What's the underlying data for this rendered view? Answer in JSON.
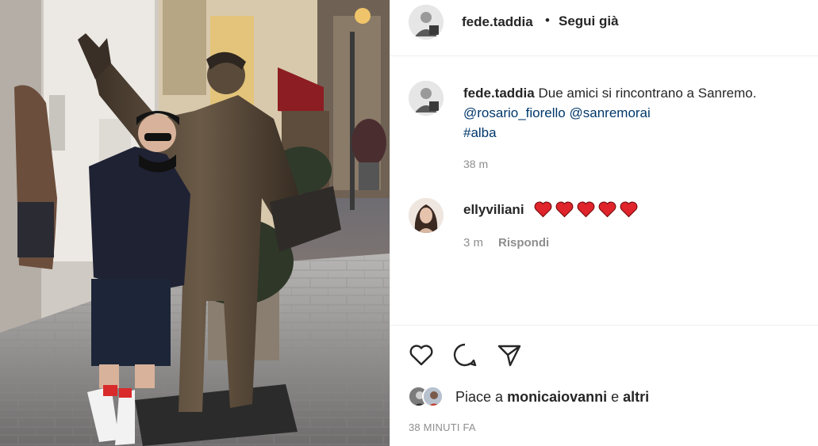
{
  "post": {
    "author": "fede.taddia",
    "follow_state": "Segui già",
    "dot": "•"
  },
  "caption": {
    "username": "fede.taddia",
    "text": "Due amici si rincontrano a Sanremo.",
    "mention_1": "@rosario_fiorello",
    "mention_2": "@sanremorai",
    "hashtag": "#alba",
    "time": "38 m"
  },
  "comment": {
    "username": "ellyviliani",
    "hearts": 5,
    "time": "3 m",
    "reply_label": "Rispondi"
  },
  "likes": {
    "prefix": "Piace a",
    "user": "monicaiovanni",
    "connector": "e",
    "others": "altri"
  },
  "timestamp": "38 MINUTI FA",
  "icons": {
    "like": "heart-outline-icon",
    "comment": "speech-bubble-icon",
    "share": "paper-plane-icon",
    "heart_color": "#ed4956"
  }
}
